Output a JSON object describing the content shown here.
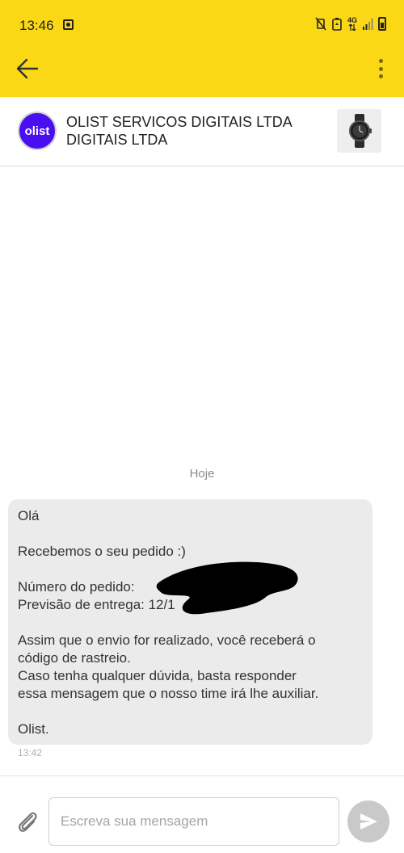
{
  "status_bar": {
    "time": "13:46",
    "network_label": "4G",
    "icons": [
      "app-notification-icon",
      "mute-vibrate-icon",
      "battery-saver-icon",
      "network-arrows-icon",
      "signal-icon",
      "battery-icon"
    ]
  },
  "app_bar": {
    "back_icon": "arrow-left-icon",
    "menu_icon": "more-vertical-icon",
    "background_color": "#fbd815"
  },
  "conversation": {
    "avatar_text": "olist",
    "avatar_color": "#4a0ff0",
    "seller_name": "OLIST SERVICOS DIGITAIS LTDA DIGITAIS LTDA",
    "product_thumbnail_icon": "smartwatch-icon"
  },
  "messages": {
    "date_label": "Hoje",
    "items": [
      {
        "lines": [
          "Olá",
          "",
          "Recebemos o seu pedido :)",
          "",
          "Número do pedido: ",
          "Previsão de entrega: 12/1",
          "",
          "Assim que o envio for realizado, você receberá o",
          "código de rastreio.",
          "Caso tenha qualquer dúvida, basta responder",
          "essa mensagem que o nosso time irá lhe auxiliar.",
          "",
          "Olist."
        ],
        "time": "13:42"
      }
    ]
  },
  "composer": {
    "placeholder": "Escreva sua mensagem",
    "value": "",
    "attach_icon": "paperclip-icon",
    "send_icon": "send-icon"
  }
}
